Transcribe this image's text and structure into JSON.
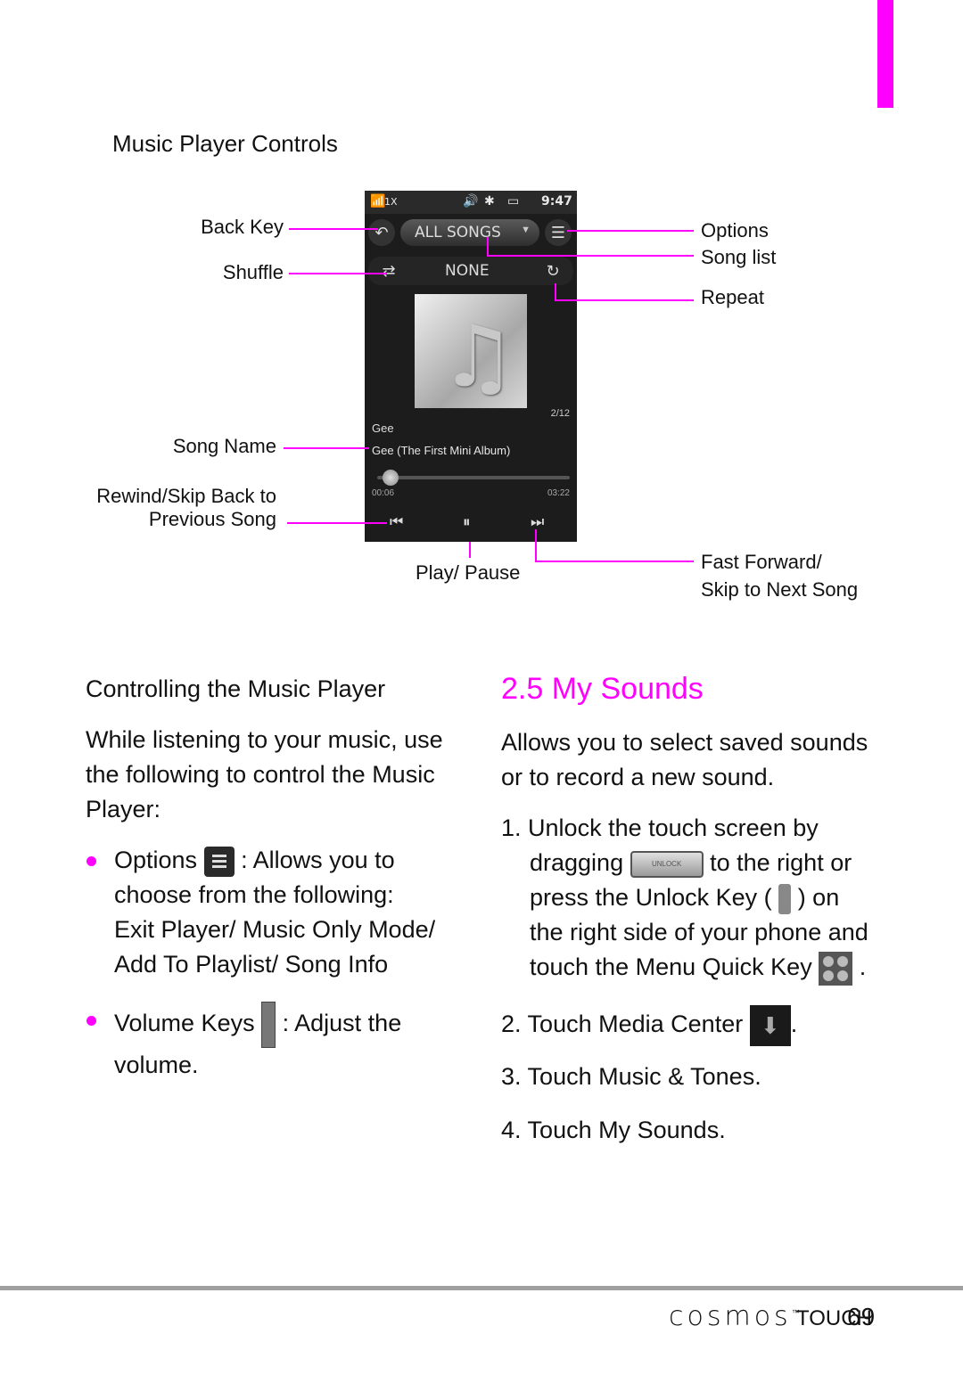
{
  "accent_color": "#ff00ff",
  "figure": {
    "title": "Music Player Controls",
    "phone": {
      "status": {
        "network": "1X",
        "time": "9:47"
      },
      "header_pill": "ALL SONGS",
      "repeat_mode": "NONE",
      "track_count": "2/12",
      "song_title": "Gee",
      "album": "Gee (The First Mini Album)",
      "progress": {
        "elapsed": "00:06",
        "total": "03:22",
        "fraction": 0.03
      }
    },
    "callouts": {
      "back_key": "Back Key",
      "shuffle": "Shuffle",
      "song_name": "Song Name",
      "rewind_line1": "Rewind/Skip Back to",
      "rewind_line2": "Previous Song",
      "options": "Options",
      "song_list": "Song list",
      "repeat": "Repeat",
      "play_pause": "Play/ Pause",
      "ff_line1": "Fast Forward/",
      "ff_line2": "Skip to Next Song"
    }
  },
  "left": {
    "heading": "Controlling the Music Player",
    "intro": [
      "While listening to your music, use",
      "the following to control the Music",
      "Player:"
    ],
    "bullets": {
      "options_label": "Options",
      "options_text": ": Allows you to",
      "options_line2": "choose from the following:",
      "options_line3": "Exit Player/ Music Only Mode/",
      "options_line4": "Add To Playlist/ Song Info",
      "volume_label": "Volume Keys",
      "volume_text": ": Adjust the",
      "volume_line2": "volume."
    }
  },
  "right": {
    "section_title": "2.5 My Sounds",
    "intro": [
      "Allows you to select saved sounds",
      "or to record a new sound."
    ],
    "step1": {
      "num": "1.",
      "l1": "Unlock the touch screen by",
      "l2a": "dragging",
      "unlock_icon_text": "UNLOCK",
      "l2b": "to the right or",
      "l3a": "press the",
      "l3b": "Unlock Key",
      "l3c": "(",
      "l3d": ") on",
      "l4": "the right side of your phone and",
      "l5a": "touch the",
      "l5b": "Menu Quick Key",
      "l5c": "."
    },
    "step2": {
      "num": "2.",
      "a": "Touch",
      "b": "Media Center",
      "c": "."
    },
    "step3": {
      "num": "3.",
      "a": "Touch",
      "b": "Music & Tones",
      "c": "."
    },
    "step4": {
      "num": "4.",
      "a": "Touch",
      "b": "My Sounds",
      "c": "."
    }
  },
  "footer": {
    "brand": "cosmos",
    "tm": "™",
    "touch": "TOUCH",
    "page": "69"
  }
}
